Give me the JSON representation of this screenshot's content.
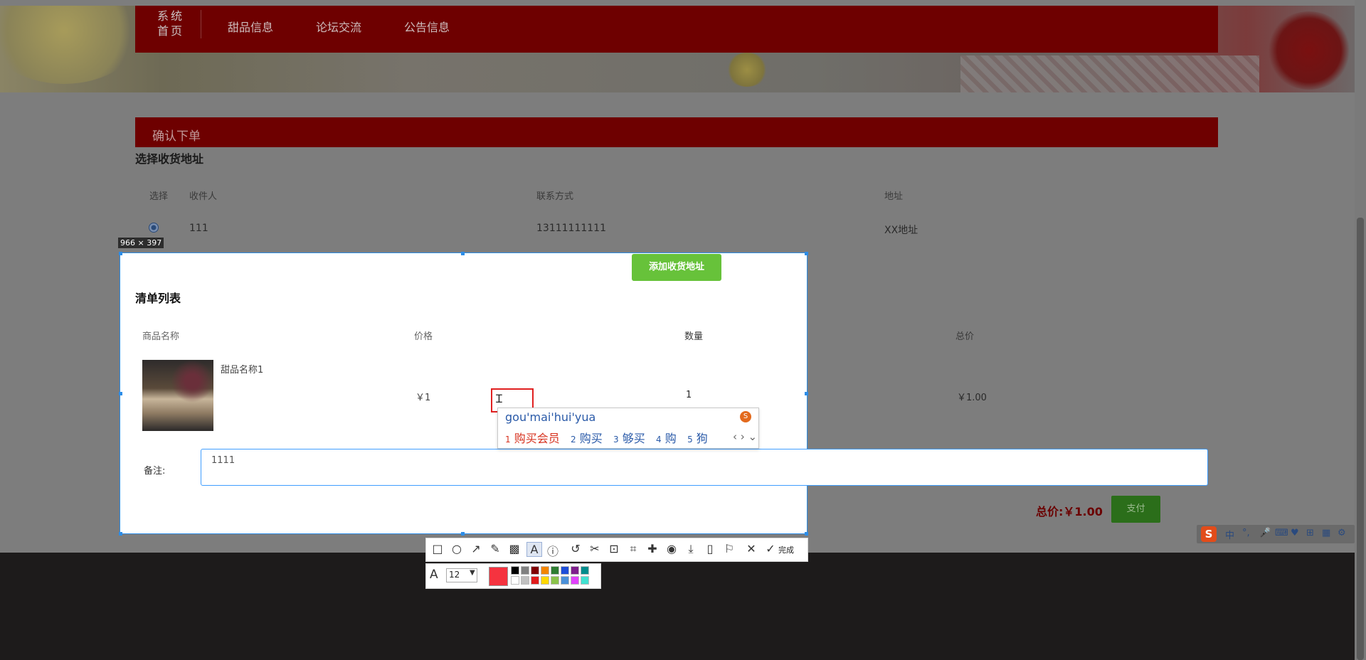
{
  "nav": {
    "home": "系统首页",
    "items": [
      "甜品信息",
      "论坛交流",
      "公告信息"
    ]
  },
  "confirm": {
    "title": "确认下单"
  },
  "address": {
    "section_title": "选择收货地址",
    "headers": [
      "选择",
      "收件人",
      "联系方式",
      "地址"
    ],
    "rows": [
      {
        "name": "111",
        "phone": "13111111111",
        "addr": "XX地址"
      }
    ],
    "add_button": "添加收货地址"
  },
  "cart": {
    "title": "清单列表",
    "headers": [
      "商品名称",
      "价格",
      "数量",
      "总价"
    ],
    "rows": [
      {
        "name": "甜品名称1",
        "price": "￥1",
        "qty": "1",
        "total": "￥1.00"
      }
    ],
    "note_label": "备注:",
    "note_value": "1111",
    "total_label": "总价:",
    "total_value": "￥1.00",
    "pay_button": "支付"
  },
  "screenshot": {
    "size_badge": "966 × 397",
    "done_label": "完成",
    "font_size": "12",
    "selected_color": "#f5333f",
    "palette": [
      "#000000",
      "#808080",
      "#800000",
      "#f28500",
      "#2e7d32",
      "#1d4ed8",
      "#7e1e8c",
      "#008b8b",
      "#ffffff",
      "#c0c0c0",
      "#e01b1b",
      "#ffd700",
      "#8bc34a",
      "#4a90d9",
      "#e040fb",
      "#40e0d0"
    ],
    "tools": [
      "rect-icon",
      "ellipse-icon",
      "arrow-icon",
      "pencil-icon",
      "mosaic-icon",
      "text-icon",
      "number-icon",
      "undo-icon",
      "scissors-icon",
      "ocr-icon",
      "crop-icon",
      "pin-icon",
      "record-icon",
      "download-icon",
      "long-shot-icon",
      "bookmark-icon",
      "close-icon",
      "check-icon"
    ]
  },
  "ime": {
    "pinyin": "gou'mai'hui'yua",
    "candidates": [
      {
        "num": "1",
        "text": "购买会员"
      },
      {
        "num": "2",
        "text": "购买"
      },
      {
        "num": "3",
        "text": "够买"
      },
      {
        "num": "4",
        "text": "购"
      },
      {
        "num": "5",
        "text": "狗"
      }
    ]
  },
  "tray": {
    "lang": "中",
    "punct": "°,"
  }
}
